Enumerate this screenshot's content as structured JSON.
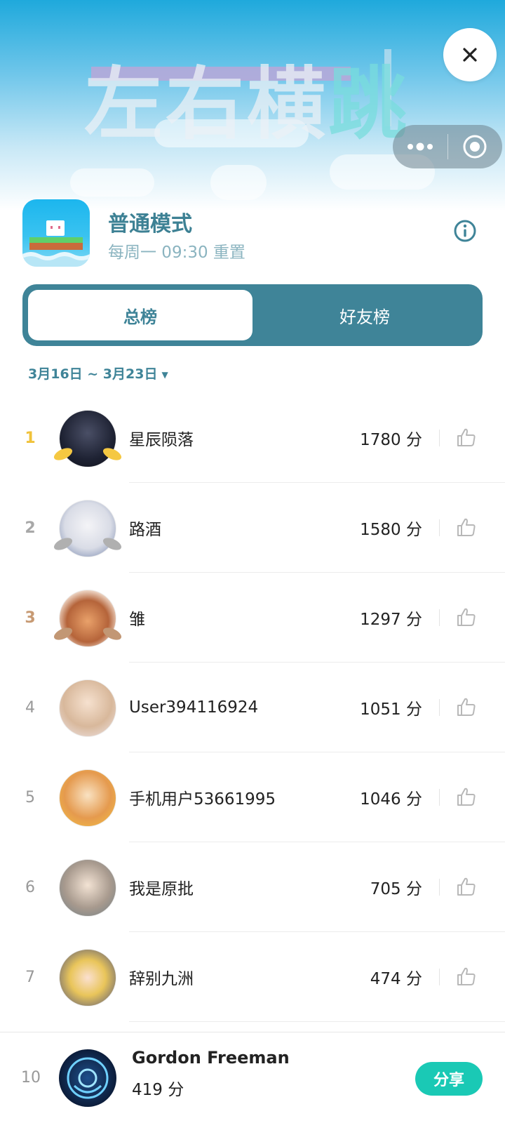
{
  "banner": {
    "title_part": "左右横",
    "title_last": "跳"
  },
  "header": {
    "mode_title": "普通模式",
    "reset_text": "每周一 09:30 重置"
  },
  "tabs": [
    {
      "label": "总榜",
      "active": true
    },
    {
      "label": "好友榜",
      "active": false
    }
  ],
  "date_range": "3月16日 ~ 3月23日",
  "score_unit": "分",
  "ranking": [
    {
      "rank": "1",
      "name": "星辰陨落",
      "score": "1780 分"
    },
    {
      "rank": "2",
      "name": "路酒",
      "score": "1580 分"
    },
    {
      "rank": "3",
      "name": "雏",
      "score": "1297 分"
    },
    {
      "rank": "4",
      "name": "User394116924",
      "score": "1051 分"
    },
    {
      "rank": "5",
      "name": "手机用户53661995",
      "score": "1046 分"
    },
    {
      "rank": "6",
      "name": "我是原批",
      "score": "705 分"
    },
    {
      "rank": "7",
      "name": "辞别九洲",
      "score": "474 分"
    }
  ],
  "self": {
    "rank": "10",
    "name": "Gordon Freeman",
    "score": "419 分",
    "share_label": "分享"
  },
  "colors": {
    "teal": "#3f8498",
    "share": "#1ac9b5",
    "gold": "#f0c23a",
    "silver": "#a8a8a8",
    "bronze": "#c79a73"
  },
  "icons": {
    "close": "close-icon",
    "more": "more-dots-icon",
    "capsule_close": "target-circle-icon",
    "info": "info-icon",
    "like": "thumbs-up-icon"
  }
}
